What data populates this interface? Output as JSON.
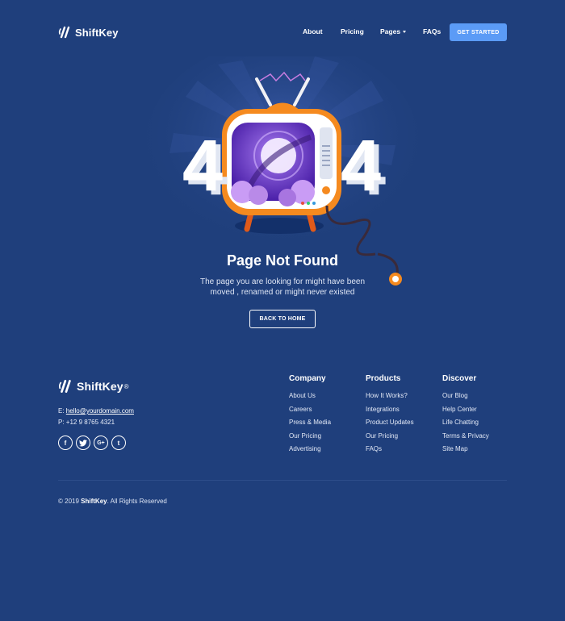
{
  "brand": {
    "name": "ShiftKey",
    "reg_mark": "®"
  },
  "nav": {
    "items": [
      {
        "label": "About"
      },
      {
        "label": "Pricing"
      },
      {
        "label": "Pages"
      },
      {
        "label": "FAQs"
      }
    ],
    "cta_label": "GET STARTED"
  },
  "hero": {
    "error_digit_left": "4",
    "error_digit_right": "4",
    "title": "Page Not Found",
    "description_line1": "The page you are looking for might have been",
    "description_line2": "moved , renamed or might never existed",
    "button_label": "BACK TO HOME"
  },
  "footer": {
    "email_prefix": "E:",
    "email": "hello@yourdomain.com",
    "phone_prefix": "P:",
    "phone": "+12 9 8765 4321",
    "socials": [
      {
        "icon": "facebook-icon",
        "glyph": "f"
      },
      {
        "icon": "twitter-icon",
        "glyph": "t"
      },
      {
        "icon": "google-plus-icon",
        "glyph": "G+"
      },
      {
        "icon": "tumblr-icon",
        "glyph": "t"
      }
    ],
    "columns": [
      {
        "title": "Company",
        "links": [
          "About Us",
          "Careers",
          "Press & Media",
          "Our Pricing",
          "Advertising"
        ]
      },
      {
        "title": "Products",
        "links": [
          "How It Works?",
          "Integrations",
          "Product Updates",
          "Our Pricing",
          "FAQs"
        ]
      },
      {
        "title": "Discover",
        "links": [
          "Our Blog",
          "Help Center",
          "Life Chatting",
          "Terms & Privacy",
          "Site Map"
        ]
      }
    ],
    "copyright_prefix": "© 2019",
    "copyright_brand": "ShiftKey",
    "copyright_suffix": ". All Rights Reserved"
  },
  "colors": {
    "background": "#1f3f7c",
    "accent": "#5b9bf6",
    "tv_orange": "#f58a1f",
    "screen_purple": "#7b3fd6"
  }
}
